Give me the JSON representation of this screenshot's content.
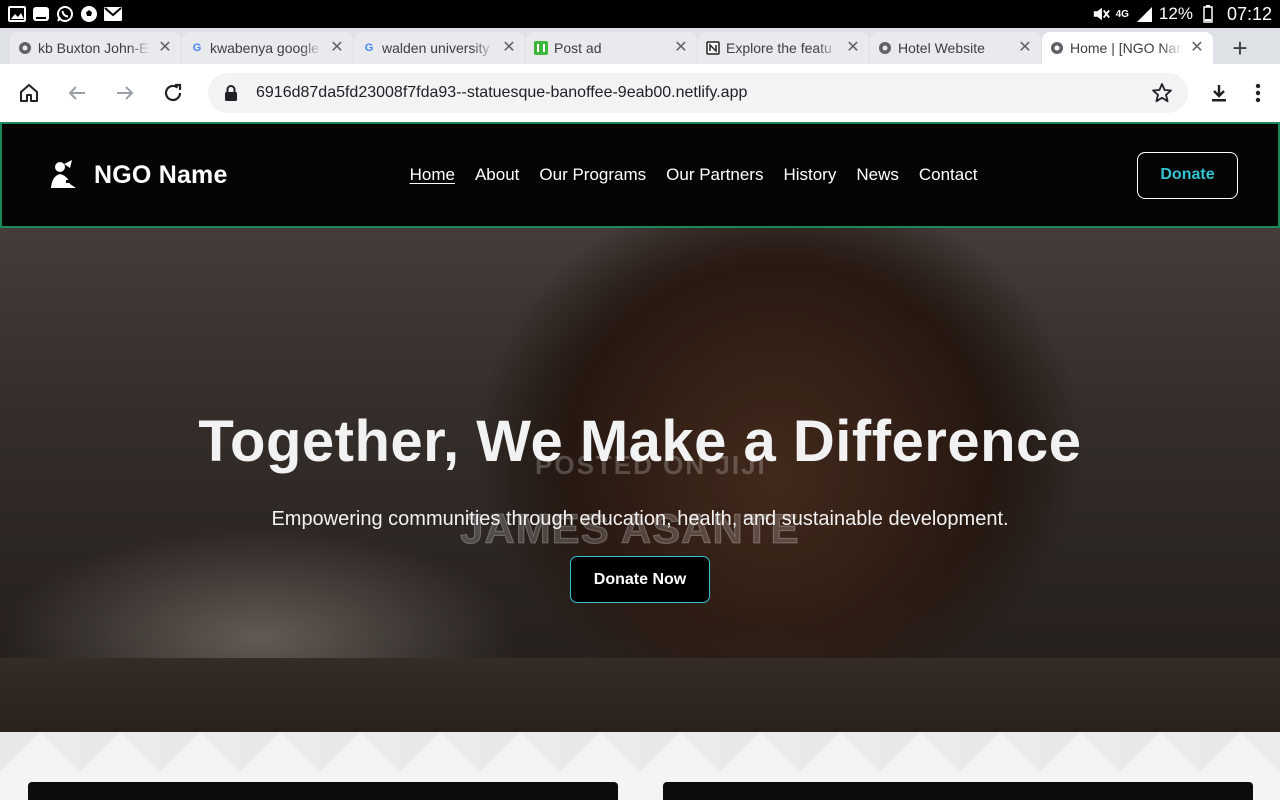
{
  "status_bar": {
    "left_icons": [
      "gallery-icon",
      "message-icon",
      "whatsapp-icon",
      "soccer-icon",
      "mail-icon"
    ],
    "network": "4G",
    "battery": "12%",
    "time": "07:12"
  },
  "tabs": [
    {
      "title": "kb Buxton John-E",
      "icon": "globe-icon",
      "active": false
    },
    {
      "title": "kwabenya google",
      "icon": "google-icon",
      "active": false
    },
    {
      "title": "walden university",
      "icon": "google-icon",
      "active": false
    },
    {
      "title": "Post ad",
      "icon": "jiji-icon",
      "active": false
    },
    {
      "title": "Explore the featu",
      "icon": "notion-icon",
      "active": false
    },
    {
      "title": "Hotel Website",
      "icon": "globe-icon",
      "active": false
    },
    {
      "title": "Home | [NGO Nam",
      "icon": "globe-icon",
      "active": true
    }
  ],
  "toolbar": {
    "url": "6916d87da5fd23008f7fda93--statuesque-banoffee-9eab00.netlify.app"
  },
  "site": {
    "brand": "NGO Name",
    "nav": [
      {
        "label": "Home",
        "active": true
      },
      {
        "label": "About",
        "active": false
      },
      {
        "label": "Our Programs",
        "active": false
      },
      {
        "label": "Our Partners",
        "active": false
      },
      {
        "label": "History",
        "active": false
      },
      {
        "label": "News",
        "active": false
      },
      {
        "label": "Contact",
        "active": false
      }
    ],
    "donate_label": "Donate",
    "hero": {
      "title": "Together, We Make a Difference",
      "subtitle": "Empowering communities through education, health, and sustainable development.",
      "cta": "Donate Now",
      "watermark_top": "POSTED ON JIJI",
      "watermark_bottom": "JAMES ASANTE"
    }
  },
  "colors": {
    "accent": "#34c3d1",
    "nav_border": "#1c8a58",
    "nav_bg": "#050505"
  }
}
